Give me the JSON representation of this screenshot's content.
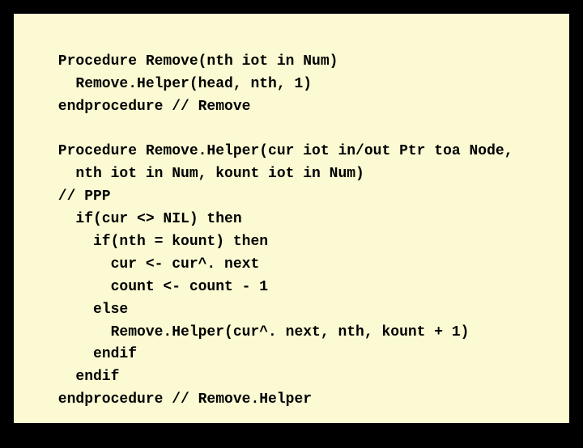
{
  "code": {
    "lines": [
      " Procedure Remove(nth iot in Num)",
      "   Remove.Helper(head, nth, 1)",
      " endprocedure // Remove",
      "",
      " Procedure Remove.Helper(cur iot in/out Ptr toa Node,",
      "   nth iot in Num, kount iot in Num)",
      " // PPP",
      "   if(cur <> NIL) then",
      "     if(nth = kount) then",
      "       cur <- cur^. next",
      "       count <- count - 1",
      "     else",
      "       Remove.Helper(cur^. next, nth, kount + 1)",
      "     endif",
      "   endif",
      " endprocedure // Remove.Helper"
    ]
  }
}
